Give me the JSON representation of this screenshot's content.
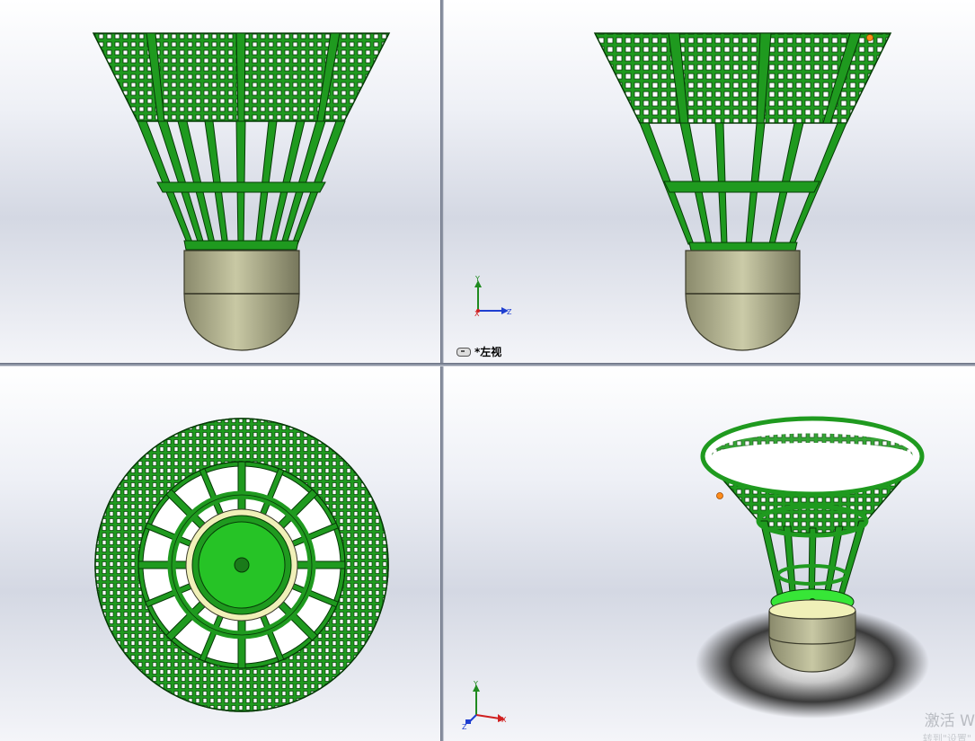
{
  "viewports": {
    "top_left": {
      "name": "front-view"
    },
    "top_right": {
      "view_label": "*左视"
    },
    "bottom_left": {
      "name": "top-view"
    },
    "bottom_right": {
      "name": "isometric-view"
    }
  },
  "triad": {
    "x_label": "X",
    "y_label": "Y",
    "z_label": "Z"
  },
  "watermark": {
    "line1": "激活 W",
    "line2": "转到\"设置\""
  },
  "colors": {
    "skirt_green": "#1f9a1f",
    "skirt_dark": "#0a4d0a",
    "cork": "#a8a88a",
    "cork_dark": "#5a5a45",
    "ring_yellow": "#f0f0b8",
    "axis_x": "#d02020",
    "axis_y": "#1f8a1f",
    "axis_z": "#1f3fd0"
  }
}
